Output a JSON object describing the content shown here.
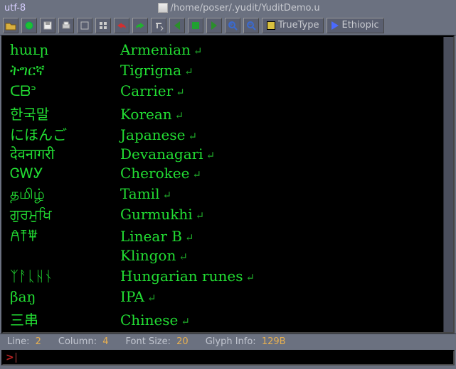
{
  "header": {
    "encoding": "utf-8",
    "path": "/home/poser/.yudit/YuditDemo.u"
  },
  "toolbar": {
    "font_renderer": "TrueType",
    "script": "Ethiopic"
  },
  "rows": [
    {
      "native": "հաւր",
      "name": "Armenian"
    },
    {
      "native": "ትግርኛ",
      "name": "Tigrigna"
    },
    {
      "native": "ᑕᗷᐣ",
      "name": "Carrier"
    },
    {
      "native": "한국말",
      "name": "Korean"
    },
    {
      "native": "にほんご",
      "name": "Japanese"
    },
    {
      "native": "देवनागरी",
      "name": "Devanagari"
    },
    {
      "native": "ᏣᎳᎩ",
      "name": "Cherokee"
    },
    {
      "native": "தமிழ்",
      "name": "Tamil"
    },
    {
      "native": "ਗੁਰਮੁਖਿ",
      "name": "Gurmukhi"
    },
    {
      "native": "𐀁𐀵𐁆",
      "name": "Linear B"
    },
    {
      "native": "",
      "name": "Klingon"
    },
    {
      "native": "ᛉᚨᚳᚺᚾ",
      "name": "Hungarian runes"
    },
    {
      "native": "βaŋ",
      "name": "IPA"
    },
    {
      "native": "三串",
      "name": "Chinese"
    }
  ],
  "status": {
    "line_label": "Line:",
    "line_value": "2",
    "col_label": "Column:",
    "col_value": "4",
    "font_label": "Font Size:",
    "font_value": "20",
    "glyph_label": "Glyph Info:",
    "glyph_value": "129B"
  },
  "command": {
    "prompt": ">"
  }
}
